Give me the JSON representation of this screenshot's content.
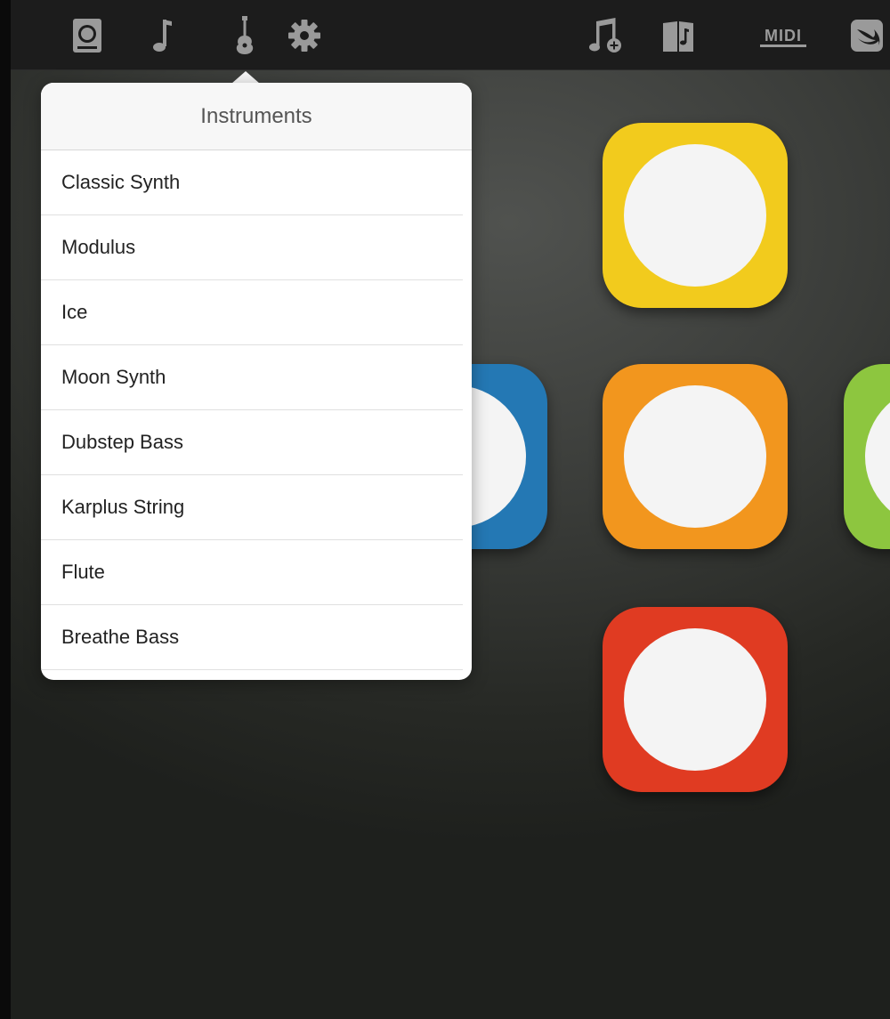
{
  "toolbar": {
    "left_icons": [
      {
        "name": "speaker-icon"
      },
      {
        "name": "music-note-icon"
      },
      {
        "name": "guitar-icon"
      },
      {
        "name": "gear-icon"
      }
    ],
    "right_icons": [
      {
        "name": "add-music-icon"
      },
      {
        "name": "songbook-icon"
      },
      {
        "name": "midi-icon",
        "label": "MIDI"
      },
      {
        "name": "swift-icon"
      }
    ],
    "icon_color": "#9a9a9a"
  },
  "popover": {
    "title": "Instruments",
    "items": [
      "Classic Synth",
      "Modulus",
      "Ice",
      "Moon Synth",
      "Dubstep Bass",
      "Karplus String",
      "Flute",
      "Breathe Bass"
    ]
  },
  "pads": [
    {
      "name": "pad-yellow",
      "color": "#f2cb1d"
    },
    {
      "name": "pad-blue",
      "color": "#2478b4"
    },
    {
      "name": "pad-orange",
      "color": "#f2961e"
    },
    {
      "name": "pad-green",
      "color": "#8dc63f"
    },
    {
      "name": "pad-red",
      "color": "#e03b22"
    }
  ]
}
